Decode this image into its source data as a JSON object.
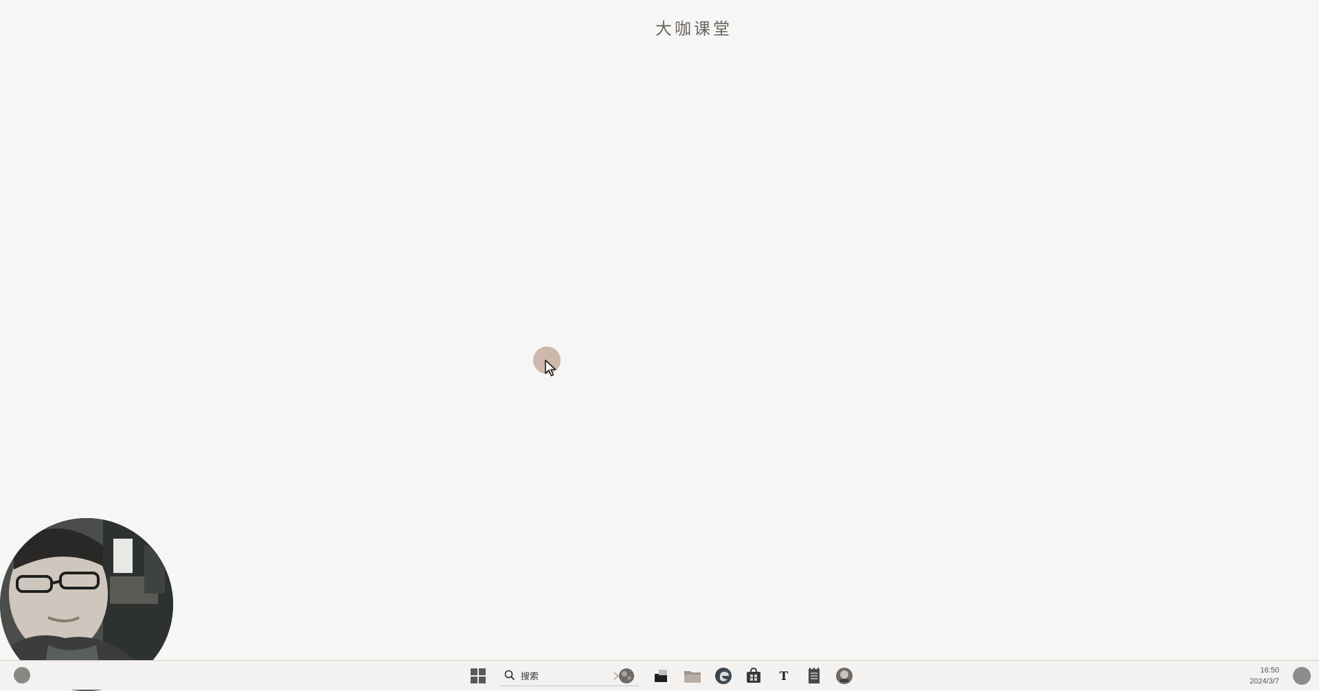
{
  "watermark": {
    "text": "大咖课堂"
  },
  "taskbar": {
    "search_placeholder": "搜索",
    "clock_time": "16:50",
    "clock_date": "2024/3/7",
    "icons": [
      "start-icon",
      "search-icon",
      "widgets-icon",
      "task-view-icon",
      "file-explorer-icon",
      "edge-browser-icon",
      "store-icon",
      "typora-icon",
      "notepad-icon",
      "app-icon"
    ]
  },
  "colors": {
    "desktop_bg": "#f6f6f5",
    "cursor_halo": "#cdb8ab",
    "taskbar_bg": "#f3f2f1"
  }
}
